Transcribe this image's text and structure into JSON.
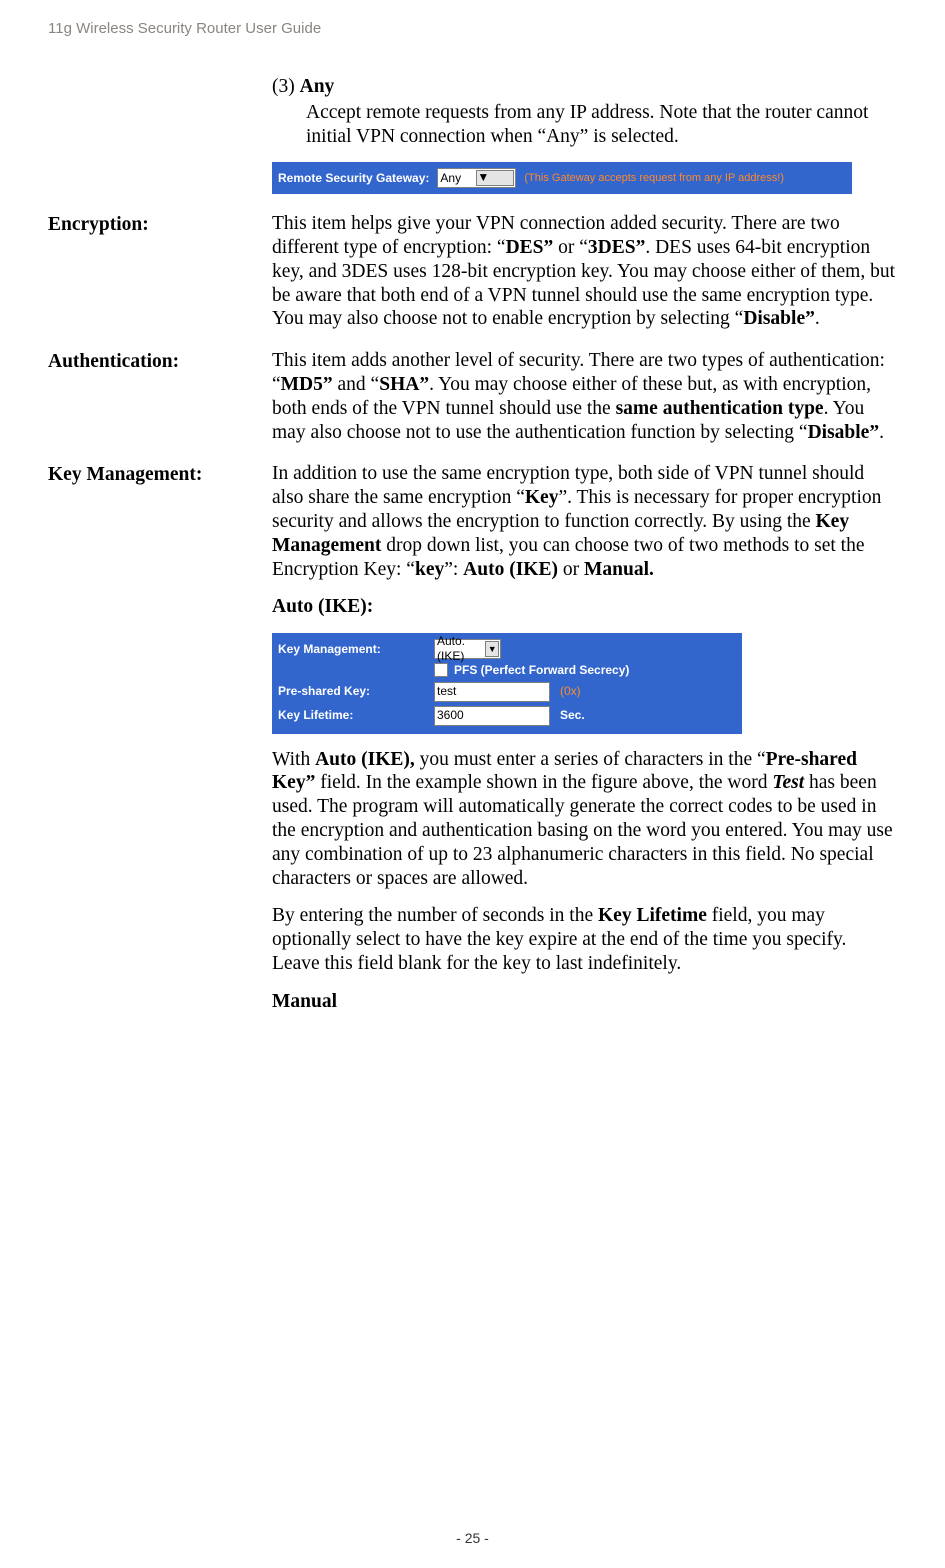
{
  "header": "11g Wireless Security Router User Guide",
  "footer": "- 25 -",
  "section_any": {
    "prefix": "(3) ",
    "title": "Any",
    "body": "Accept remote requests from any IP address. Note that the router cannot initial VPN connection when “Any” is selected."
  },
  "fig_gateway": {
    "label": "Remote Security Gateway:",
    "select_value": "Any",
    "note": "(This Gateway accepts request from any IP address!)"
  },
  "rows": {
    "encryption": {
      "label": "Encryption:",
      "p1a": "This item helps give your VPN connection added security. There are two different type of encryption: “",
      "p1b": "DES”",
      "p1c": " or “",
      "p1d": "3DES”",
      "p1e": ". DES uses 64-bit encryption key, and 3DES uses 128-bit encryption key. You may choose either of them, but be aware that both end of a VPN tunnel should use the same encryption type. You may also choose not to enable encryption by selecting “",
      "p1f": "Disable”",
      "p1g": "."
    },
    "authentication": {
      "label": "Authentication:",
      "p1a": "This item adds another level of security. There are two types of authentication: “",
      "p1b": "MD5”",
      "p1c": " and “",
      "p1d": "SHA”",
      "p1e": ". You may choose either of these but, as with encryption, both ends of the VPN tunnel should use the ",
      "p1f": "same authentication type",
      "p1g": ". You may also choose not to use the authentication function by selecting “",
      "p1h": "Disable”",
      "p1i": "."
    },
    "keymgmt": {
      "label": "Key Management:",
      "p1a": "In addition to use the same encryption type, both side of VPN tunnel should also share the same encryption “",
      "p1b": "Key",
      "p1c": "”. This is necessary for proper encryption security and allows the encryption to function correctly. By using the ",
      "p1d": "Key Management",
      "p1e": " drop down list, you can choose two of two methods to set the Encryption Key: “",
      "p1f": "key",
      "p1g": "”: ",
      "p1h": "Auto (IKE)",
      "p1i": " or ",
      "p1j": "Manual.",
      "sub_heading": "Auto (IKE):",
      "p2a": "With ",
      "p2b": "Auto (IKE),",
      "p2c": " you must enter a series of characters in the “",
      "p2d": "Pre-shared Key”",
      "p2e": " field. In the example shown in the figure above, the word ",
      "p2f": "Test",
      "p2g": " has been used. The program will automatically generate the correct codes to be used in the encryption and authentication basing on the word you entered. You may use any combination of up to 23 alphanumeric characters in this field. No special characters or spaces are allowed.",
      "p3a": "By entering the number of seconds in the ",
      "p3b": "Key Lifetime",
      "p3c": " field, you may optionally select to have the key expire at the end of the time you specify. Leave this field blank for the key to last indefinitely.",
      "manual_heading": "Manual"
    }
  },
  "fig_keymgmt": {
    "title": "Key Management:",
    "dropdown_value": "Auto. (IKE)",
    "pfs_label": "PFS (Perfect Forward Secrecy)",
    "psk_label": "Pre-shared Key:",
    "psk_value": "test",
    "hex_label": "(0x)",
    "lifetime_label": "Key Lifetime:",
    "lifetime_value": "3600",
    "sec_label": "Sec."
  }
}
